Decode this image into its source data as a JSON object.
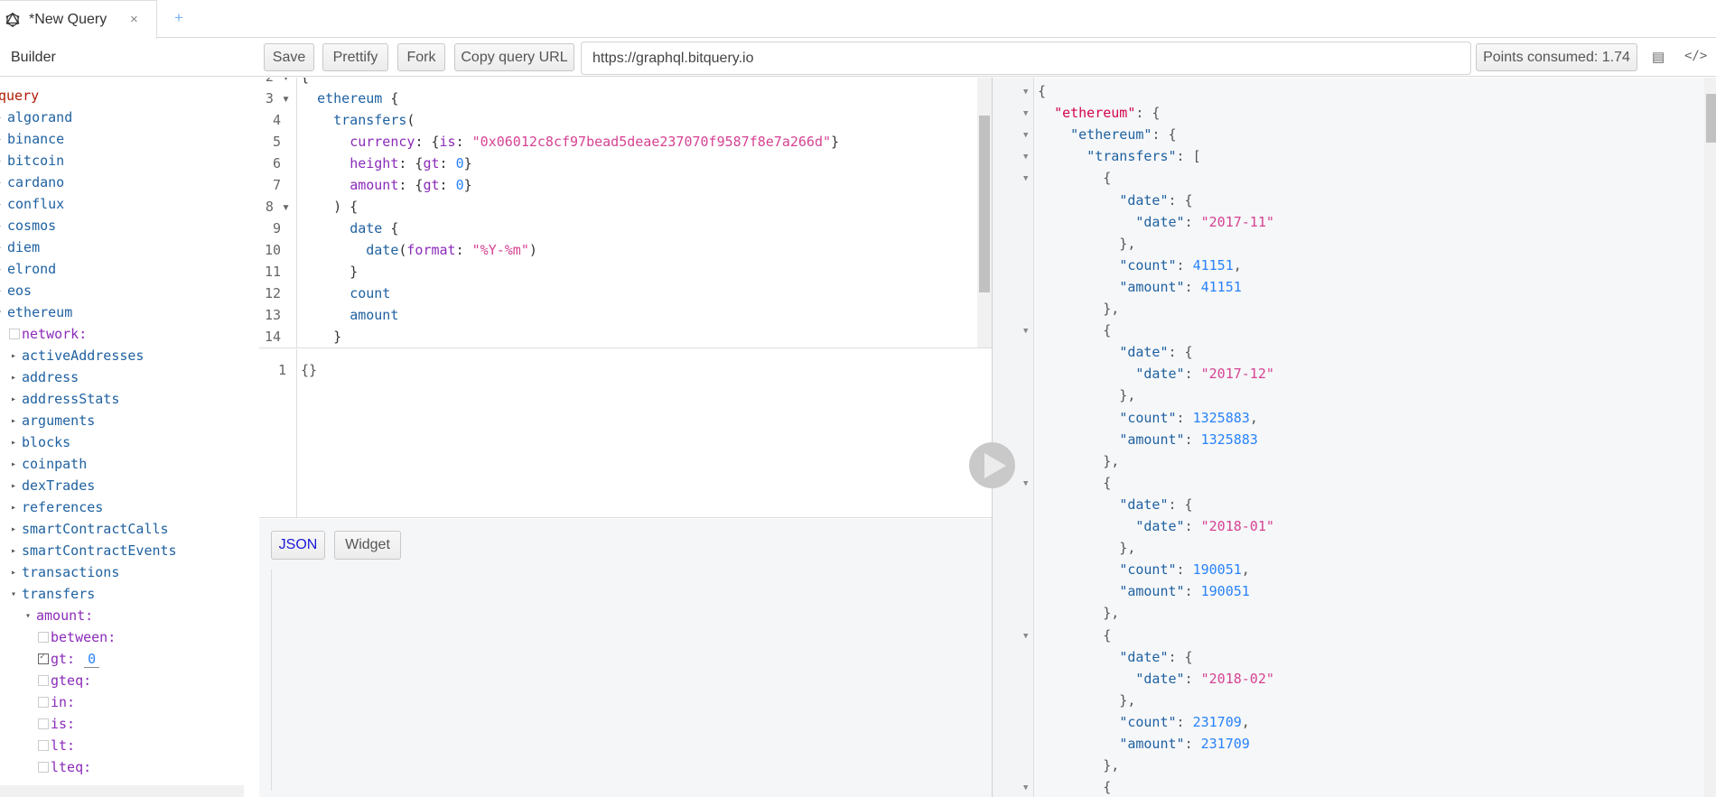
{
  "tab": {
    "title": "*New Query",
    "close": "×",
    "new_tab": "+"
  },
  "toolbar": {
    "builder": "Builder",
    "save": "Save",
    "prettify": "Prettify",
    "fork": "Fork",
    "copy_url": "Copy query URL",
    "endpoint": "https://graphql.bitquery.io",
    "points": "Points consumed: 1.74",
    "icons": [
      "schema-docs-icon",
      "code-icon"
    ]
  },
  "explorer": {
    "root": "query",
    "networks": [
      "algorand",
      "binance",
      "bitcoin",
      "cardano",
      "conflux",
      "cosmos",
      "diem",
      "elrond",
      "eos"
    ],
    "expanded": "ethereum",
    "network_arg": "network:",
    "fields": [
      "activeAddresses",
      "address",
      "addressStats",
      "arguments",
      "blocks",
      "coinpath",
      "dexTrades",
      "references",
      "smartContractCalls",
      "smartContractEvents",
      "transactions"
    ],
    "transfers": "transfers",
    "amount": "amount:",
    "amount_args": [
      {
        "label": "between:",
        "checked": false
      },
      {
        "label": "gt:",
        "checked": true,
        "value": "0"
      },
      {
        "label": "gteq:",
        "checked": false
      },
      {
        "label": "in:",
        "checked": false
      },
      {
        "label": "is:",
        "checked": false
      },
      {
        "label": "lt:",
        "checked": false
      },
      {
        "label": "lteq:",
        "checked": false
      }
    ]
  },
  "editor": {
    "lines": [
      {
        "n": "2",
        "fold": true,
        "text": "{"
      },
      {
        "n": "3",
        "fold": true,
        "text": "  ethereum {"
      },
      {
        "n": "4",
        "text": "    transfers("
      },
      {
        "n": "5",
        "text": "      currency: {is: \"0x06012c8cf97bead5deae237070f9587f8e7a266d\"}"
      },
      {
        "n": "6",
        "text": "      height: {gt: 0}"
      },
      {
        "n": "7",
        "text": "      amount: {gt: 0}"
      },
      {
        "n": "8",
        "fold": true,
        "text": "    ) {"
      },
      {
        "n": "9",
        "text": "      date {"
      },
      {
        "n": "10",
        "text": "        date(format: \"%Y-%m\")"
      },
      {
        "n": "11",
        "text": "      }"
      },
      {
        "n": "12",
        "text": "      count"
      },
      {
        "n": "13",
        "text": "      amount"
      },
      {
        "n": "14",
        "text": "    }"
      }
    ]
  },
  "variables": {
    "line": "1",
    "text": "{}"
  },
  "footer": {
    "json": "JSON",
    "widget": "Widget"
  },
  "result": {
    "lines": [
      "{",
      "  \"ethereum\": {",
      "    \"ethereum\": {",
      "      \"transfers\": [",
      "        {",
      "          \"date\": {",
      "            \"date\": \"2017-11\"",
      "          },",
      "          \"count\": 41151,",
      "          \"amount\": 41151",
      "        },",
      "        {",
      "          \"date\": {",
      "            \"date\": \"2017-12\"",
      "          },",
      "          \"count\": 1325883,",
      "          \"amount\": 1325883",
      "        },",
      "        {",
      "          \"date\": {",
      "            \"date\": \"2018-01\"",
      "          },",
      "          \"count\": 190051,",
      "          \"amount\": 190051",
      "        },",
      "        {",
      "          \"date\": {",
      "            \"date\": \"2018-02\"",
      "          },",
      "          \"count\": 231709,",
      "          \"amount\": 231709",
      "        },",
      "        {"
    ],
    "fold_lines": [
      0,
      1,
      2,
      3,
      4,
      11,
      18,
      25,
      32
    ]
  }
}
